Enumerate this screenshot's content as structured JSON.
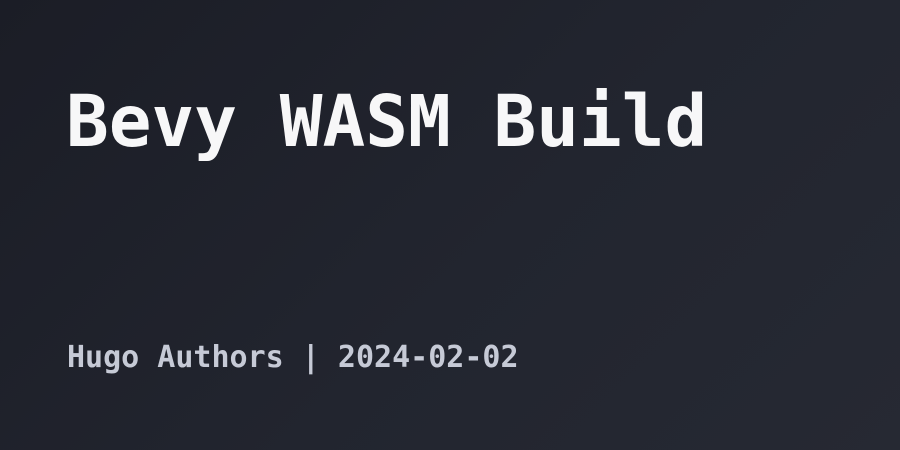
{
  "post": {
    "title": "Bevy WASM Build",
    "meta": "Hugo Authors | 2024-02-02"
  },
  "colors": {
    "background": "#1e2029",
    "title": "#f7f7f8",
    "meta": "#c6cad6"
  }
}
